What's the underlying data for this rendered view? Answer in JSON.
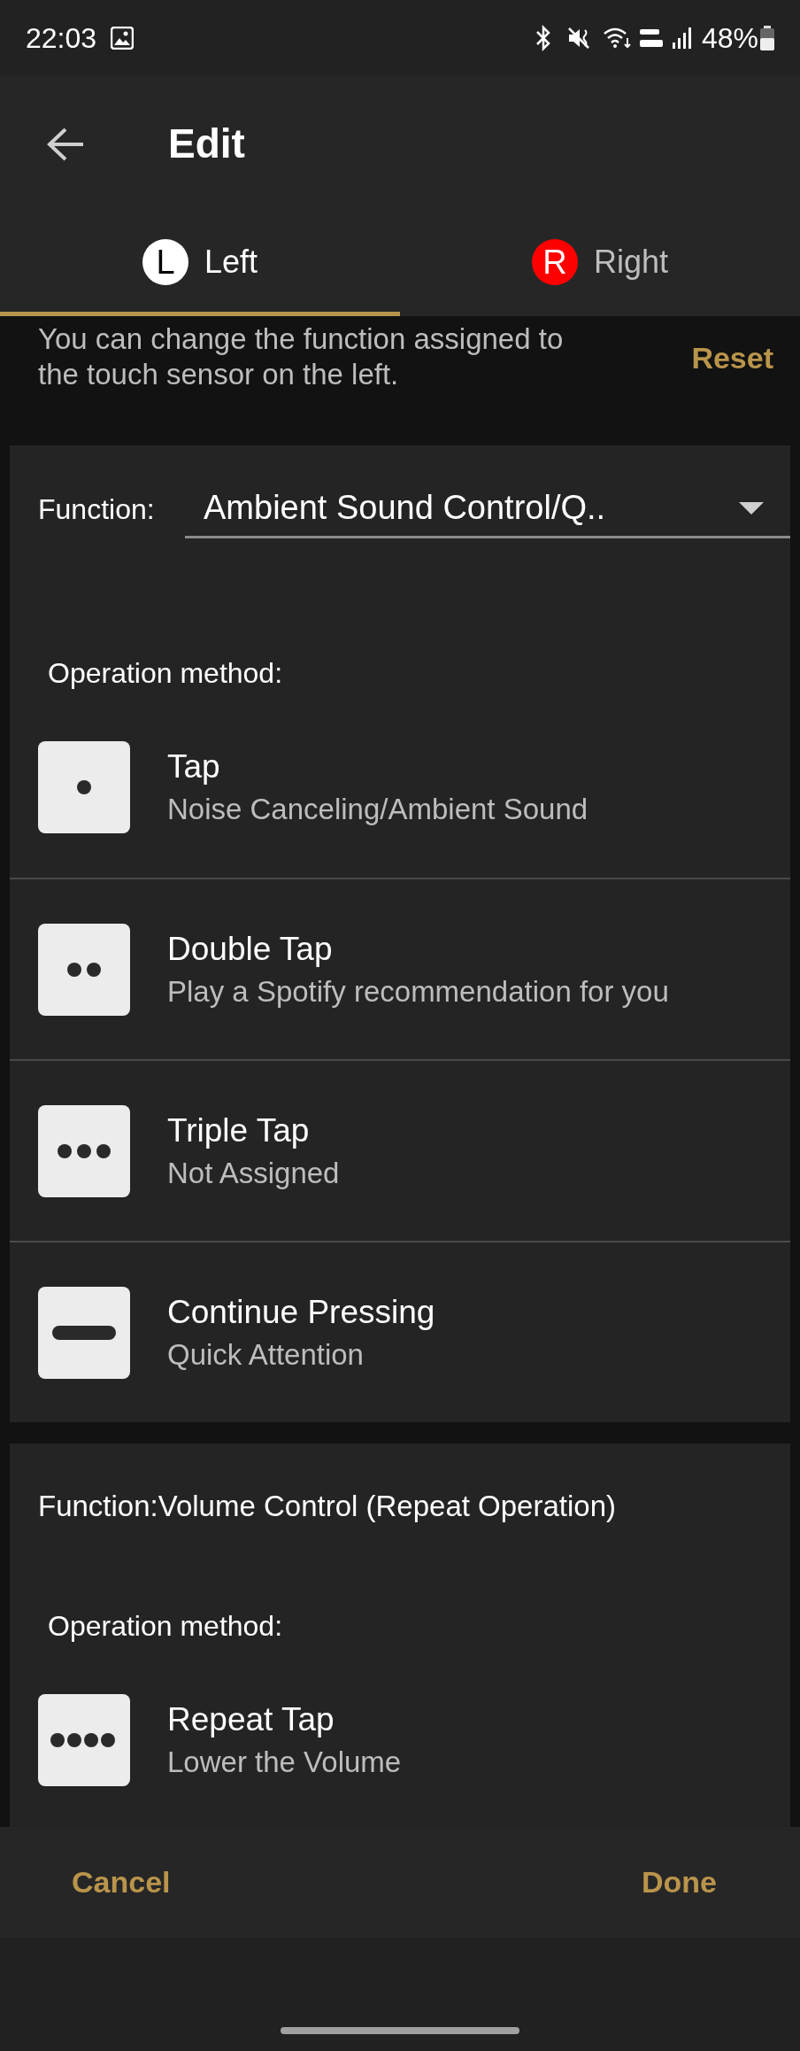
{
  "status_bar": {
    "time": "22:03",
    "battery": "48%"
  },
  "header": {
    "title": "Edit"
  },
  "tabs": [
    {
      "badge": "L",
      "label": "Left",
      "color": "#ffffff",
      "selected": true
    },
    {
      "badge": "R",
      "label": "Right",
      "color": "#ff0000",
      "selected": false
    }
  ],
  "description": "You can change the function assigned to the touch sensor on the left.",
  "reset": "Reset",
  "sections": [
    {
      "kind": "dropdown",
      "function_label": "Function:",
      "function_value": "Ambient Sound Control/Q..",
      "operation_label": "Operation method:",
      "operations": [
        {
          "kind": "single",
          "title": "Tap",
          "subtitle": "Noise Canceling/Ambient Sound"
        },
        {
          "kind": "double",
          "title": "Double Tap",
          "subtitle": "Play a Spotify recommendation for you"
        },
        {
          "kind": "triple",
          "title": "Triple Tap",
          "subtitle": "Not Assigned"
        },
        {
          "kind": "hold",
          "title": "Continue Pressing",
          "subtitle": "Quick Attention"
        }
      ]
    },
    {
      "kind": "fixed",
      "function_label": "Function:Volume Control (Repeat Operation)",
      "operation_label": "Operation method:",
      "operations": [
        {
          "kind": "quad",
          "title": "Repeat Tap",
          "subtitle": "Lower the Volume"
        }
      ]
    }
  ],
  "footer": {
    "cancel": "Cancel",
    "done": "Done"
  }
}
